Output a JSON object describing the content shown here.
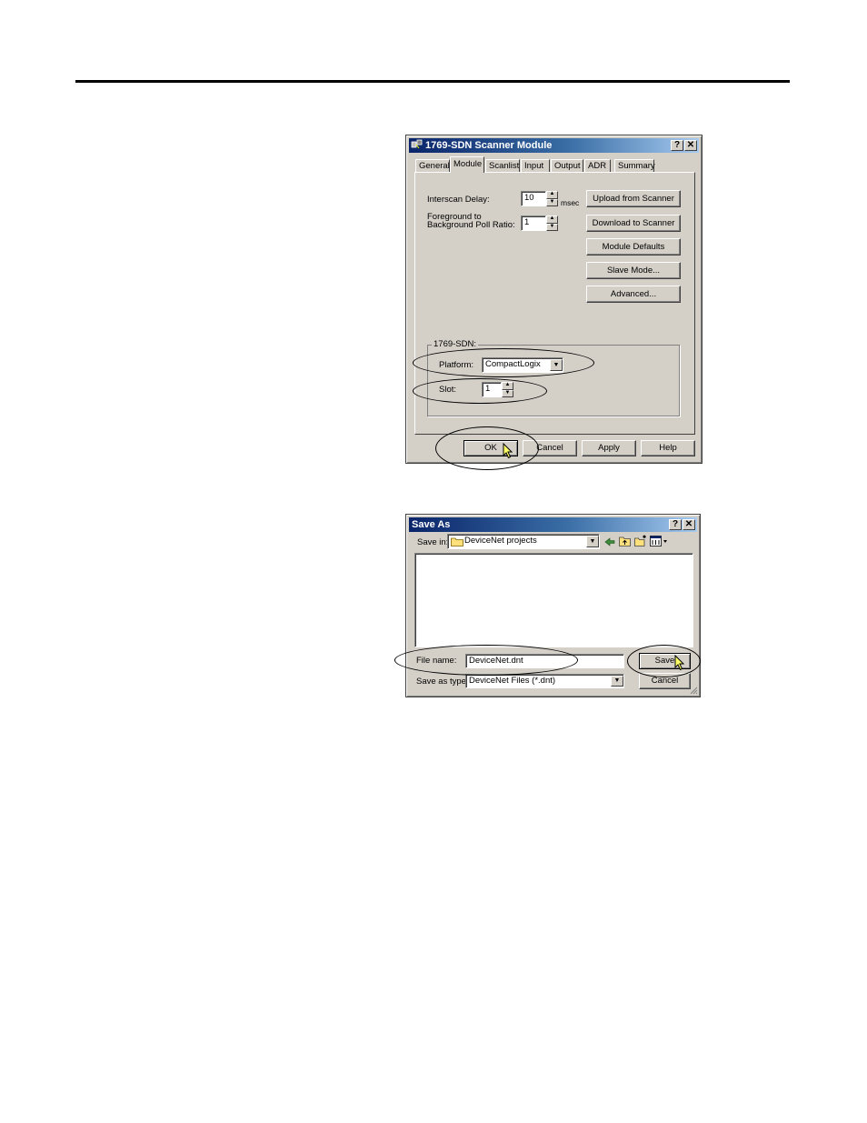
{
  "dialog1": {
    "title": "1769-SDN Scanner Module",
    "help_btn": "?",
    "close_btn": "✕",
    "tabs": [
      "General",
      "Module",
      "Scanlist",
      "Input",
      "Output",
      "ADR",
      "Summary"
    ],
    "interscan_label": "Interscan Delay:",
    "interscan_value": "10",
    "interscan_unit": "msec",
    "foreground_label_1": "Foreground to",
    "foreground_label_2": "Background Poll Ratio:",
    "foreground_value": "1",
    "buttons": {
      "upload": "Upload from Scanner",
      "download": "Download to Scanner",
      "defaults": "Module Defaults",
      "slave": "Slave Mode...",
      "advanced": "Advanced..."
    },
    "group_label": "1769-SDN:",
    "platform_label": "Platform:",
    "platform_value": "CompactLogix",
    "slot_label": "Slot:",
    "slot_value": "1",
    "ok": "OK",
    "cancel": "Cancel",
    "apply": "Apply",
    "help": "Help"
  },
  "dialog2": {
    "title": "Save As",
    "help_btn": "?",
    "close_btn": "✕",
    "save_in_label": "Save in:",
    "save_in_value": "DeviceNet projects",
    "file_name_label": "File name:",
    "file_name_value": "DeviceNet.dnt",
    "save_type_label": "Save as type:",
    "save_type_value": "DeviceNet Files (*.dnt)",
    "save": "Save",
    "cancel": "Cancel"
  }
}
